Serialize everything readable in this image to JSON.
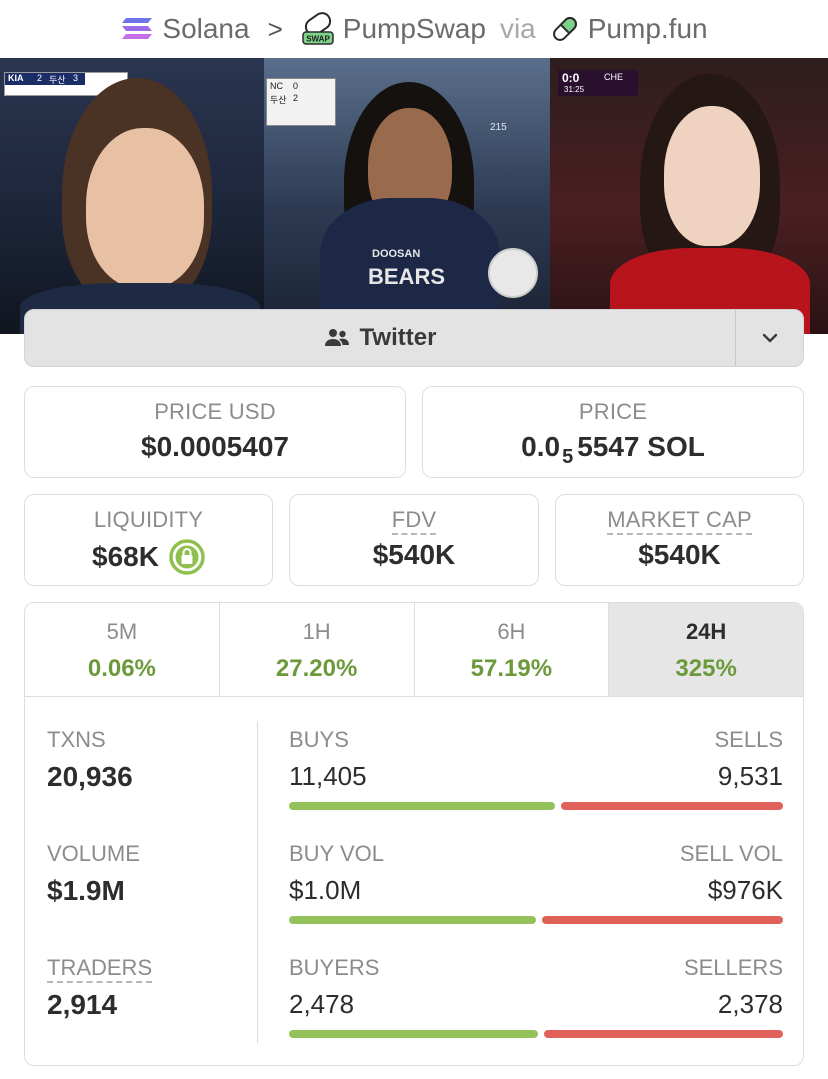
{
  "breadcrumb": {
    "chain": "Solana",
    "separator": ">",
    "dex": "PumpSwap",
    "via": "via",
    "launchpad": "Pump.fun",
    "swap_badge": "SWAP"
  },
  "banner": {
    "scorebug1": {
      "team_a": "KIA",
      "score_a": "2",
      "team_b": "두산",
      "score_b": "3"
    },
    "scorebug2": {
      "team_a": "NC",
      "score_a": "0",
      "team_b": "두산",
      "score_b": "2"
    },
    "scorebug3": {
      "score": "0:0",
      "team": "CHE",
      "clock": "31:25"
    },
    "jersey_text_1": "DOOSAN",
    "jersey_text_2": "BEARS",
    "seat_number": "215"
  },
  "social": {
    "label": "Twitter",
    "icon": "users-icon",
    "dropdown_icon": "chevron-down-icon"
  },
  "price": {
    "usd_label": "PRICE USD",
    "usd_value": "$0.0005407",
    "native_label": "PRICE",
    "native_prefix": "0.0",
    "native_zeros": "5",
    "native_digits": "5547 SOL"
  },
  "metrics": {
    "liquidity_label": "LIQUIDITY",
    "liquidity_value": "$68K",
    "fdv_label": "FDV",
    "fdv_value": "$540K",
    "mcap_label": "MARKET CAP",
    "mcap_value": "$540K"
  },
  "timeframes": [
    {
      "label": "5M",
      "change": "0.06%"
    },
    {
      "label": "1H",
      "change": "27.20%"
    },
    {
      "label": "6H",
      "change": "57.19%"
    },
    {
      "label": "24H",
      "change": "325%"
    }
  ],
  "active_timeframe": "24H",
  "stats": {
    "txns_label": "TXNS",
    "txns_value": "20,936",
    "volume_label": "VOLUME",
    "volume_value": "$1.9M",
    "traders_label": "TRADERS",
    "traders_value": "2,914"
  },
  "breakdown": {
    "buys_label": "BUYS",
    "buys_value": "11,405",
    "sells_label": "SELLS",
    "sells_value": "9,531",
    "buy_vol_label": "BUY VOL",
    "buy_vol_value": "$1.0M",
    "sell_vol_label": "SELL VOL",
    "sell_vol_value": "$976K",
    "buyers_label": "BUYERS",
    "buyers_value": "2,478",
    "sellers_label": "SELLERS",
    "sellers_value": "2,378"
  },
  "ratios": {
    "buys_share": 0.545,
    "buy_vol_share": 0.506,
    "buyers_share": 0.51
  },
  "colors": {
    "positive": "#6c9a3a",
    "buy_bar": "#94c25a",
    "sell_bar": "#e0605a",
    "lock": "#8fbf4d"
  }
}
